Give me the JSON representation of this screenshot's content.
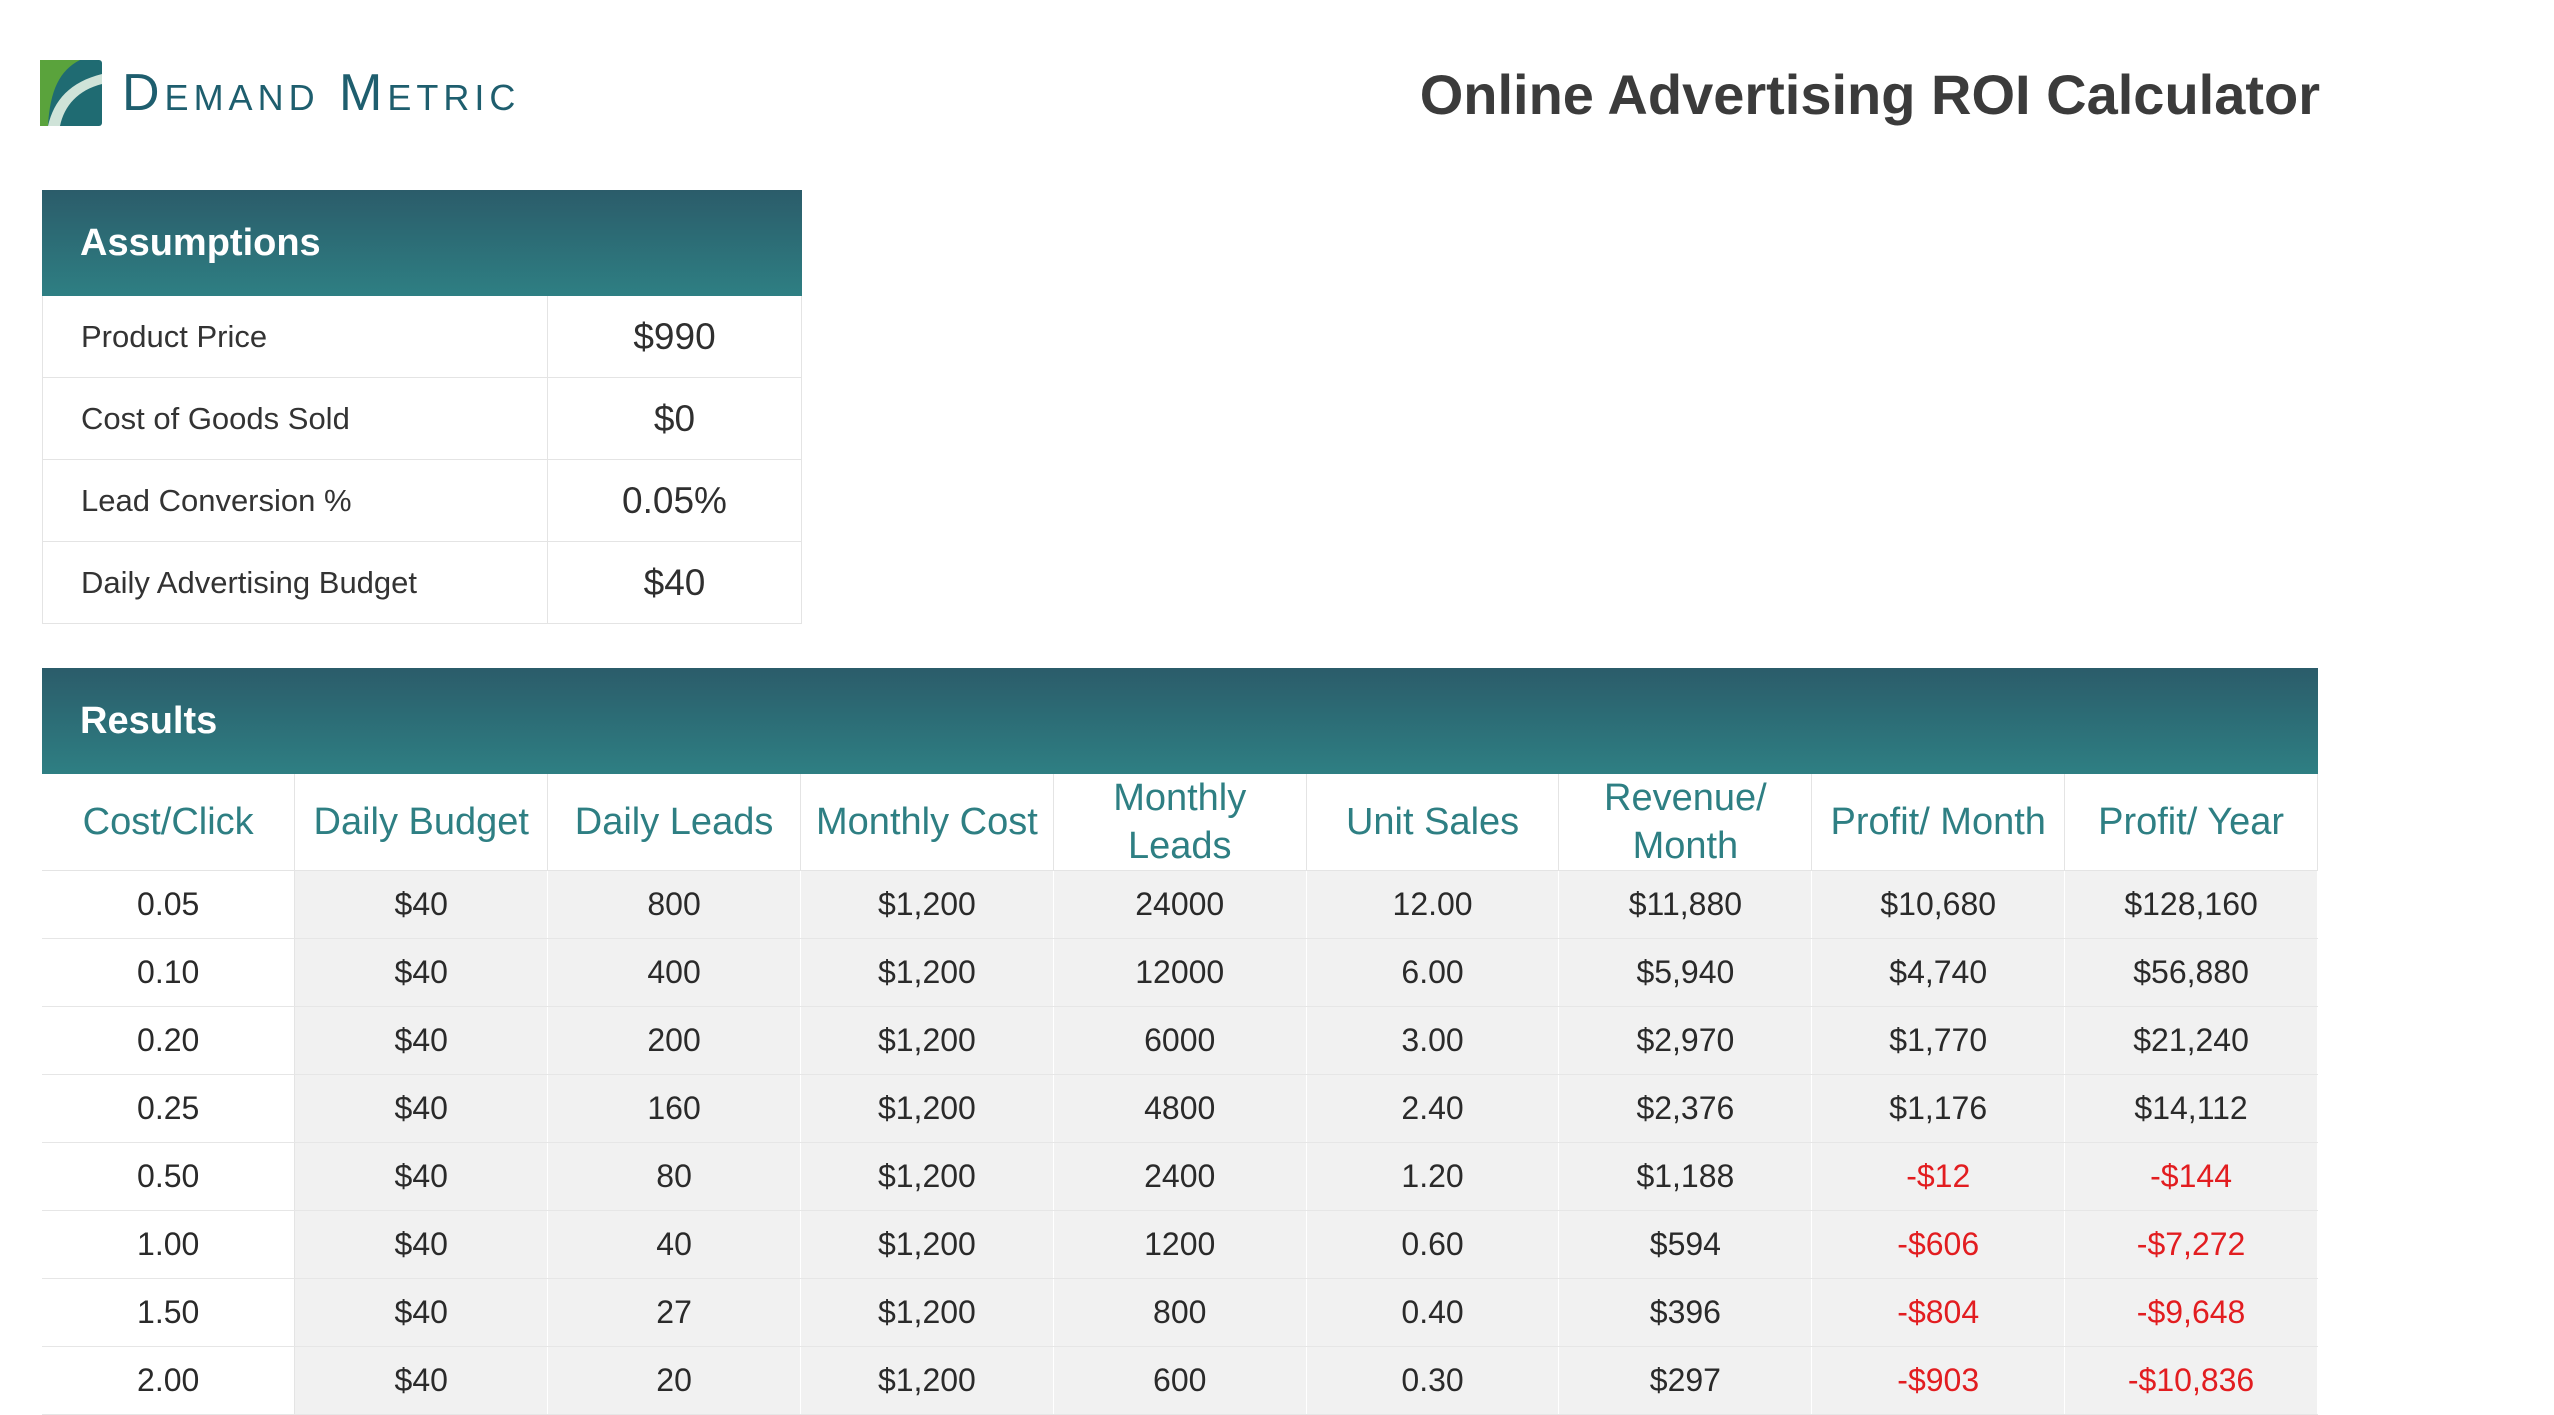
{
  "brand": {
    "name": "Demand Metric"
  },
  "title": "Online Advertising ROI Calculator",
  "assumptions": {
    "header": "Assumptions",
    "rows": [
      {
        "label": "Product Price",
        "value": "$990"
      },
      {
        "label": "Cost of Goods Sold",
        "value": "$0"
      },
      {
        "label": "Lead Conversion %",
        "value": "0.05%"
      },
      {
        "label": "Daily Advertising Budget",
        "value": "$40"
      }
    ]
  },
  "results": {
    "header": "Results",
    "columns": [
      "Cost/Click",
      "Daily Budget",
      "Daily Leads",
      "Monthly Cost",
      "Monthly Leads",
      "Unit Sales",
      "Revenue/ Month",
      "Profit/ Month",
      "Profit/ Year"
    ],
    "rows": [
      [
        "0.05",
        "$40",
        "800",
        "$1,200",
        "24000",
        "12.00",
        "$11,880",
        "$10,680",
        "$128,160"
      ],
      [
        "0.10",
        "$40",
        "400",
        "$1,200",
        "12000",
        "6.00",
        "$5,940",
        "$4,740",
        "$56,880"
      ],
      [
        "0.20",
        "$40",
        "200",
        "$1,200",
        "6000",
        "3.00",
        "$2,970",
        "$1,770",
        "$21,240"
      ],
      [
        "0.25",
        "$40",
        "160",
        "$1,200",
        "4800",
        "2.40",
        "$2,376",
        "$1,176",
        "$14,112"
      ],
      [
        "0.50",
        "$40",
        "80",
        "$1,200",
        "2400",
        "1.20",
        "$1,188",
        "-$12",
        "-$144"
      ],
      [
        "1.00",
        "$40",
        "40",
        "$1,200",
        "1200",
        "0.60",
        "$594",
        "-$606",
        "-$7,272"
      ],
      [
        "1.50",
        "$40",
        "27",
        "$1,200",
        "800",
        "0.40",
        "$396",
        "-$804",
        "-$9,648"
      ],
      [
        "2.00",
        "$40",
        "20",
        "$1,200",
        "600",
        "0.30",
        "$297",
        "-$903",
        "-$10,836"
      ]
    ]
  },
  "colors": {
    "header_bg": "#2b6b73",
    "accent": "#2e7f83",
    "negative": "#e21d20",
    "logo_green": "#4c9a3c"
  }
}
